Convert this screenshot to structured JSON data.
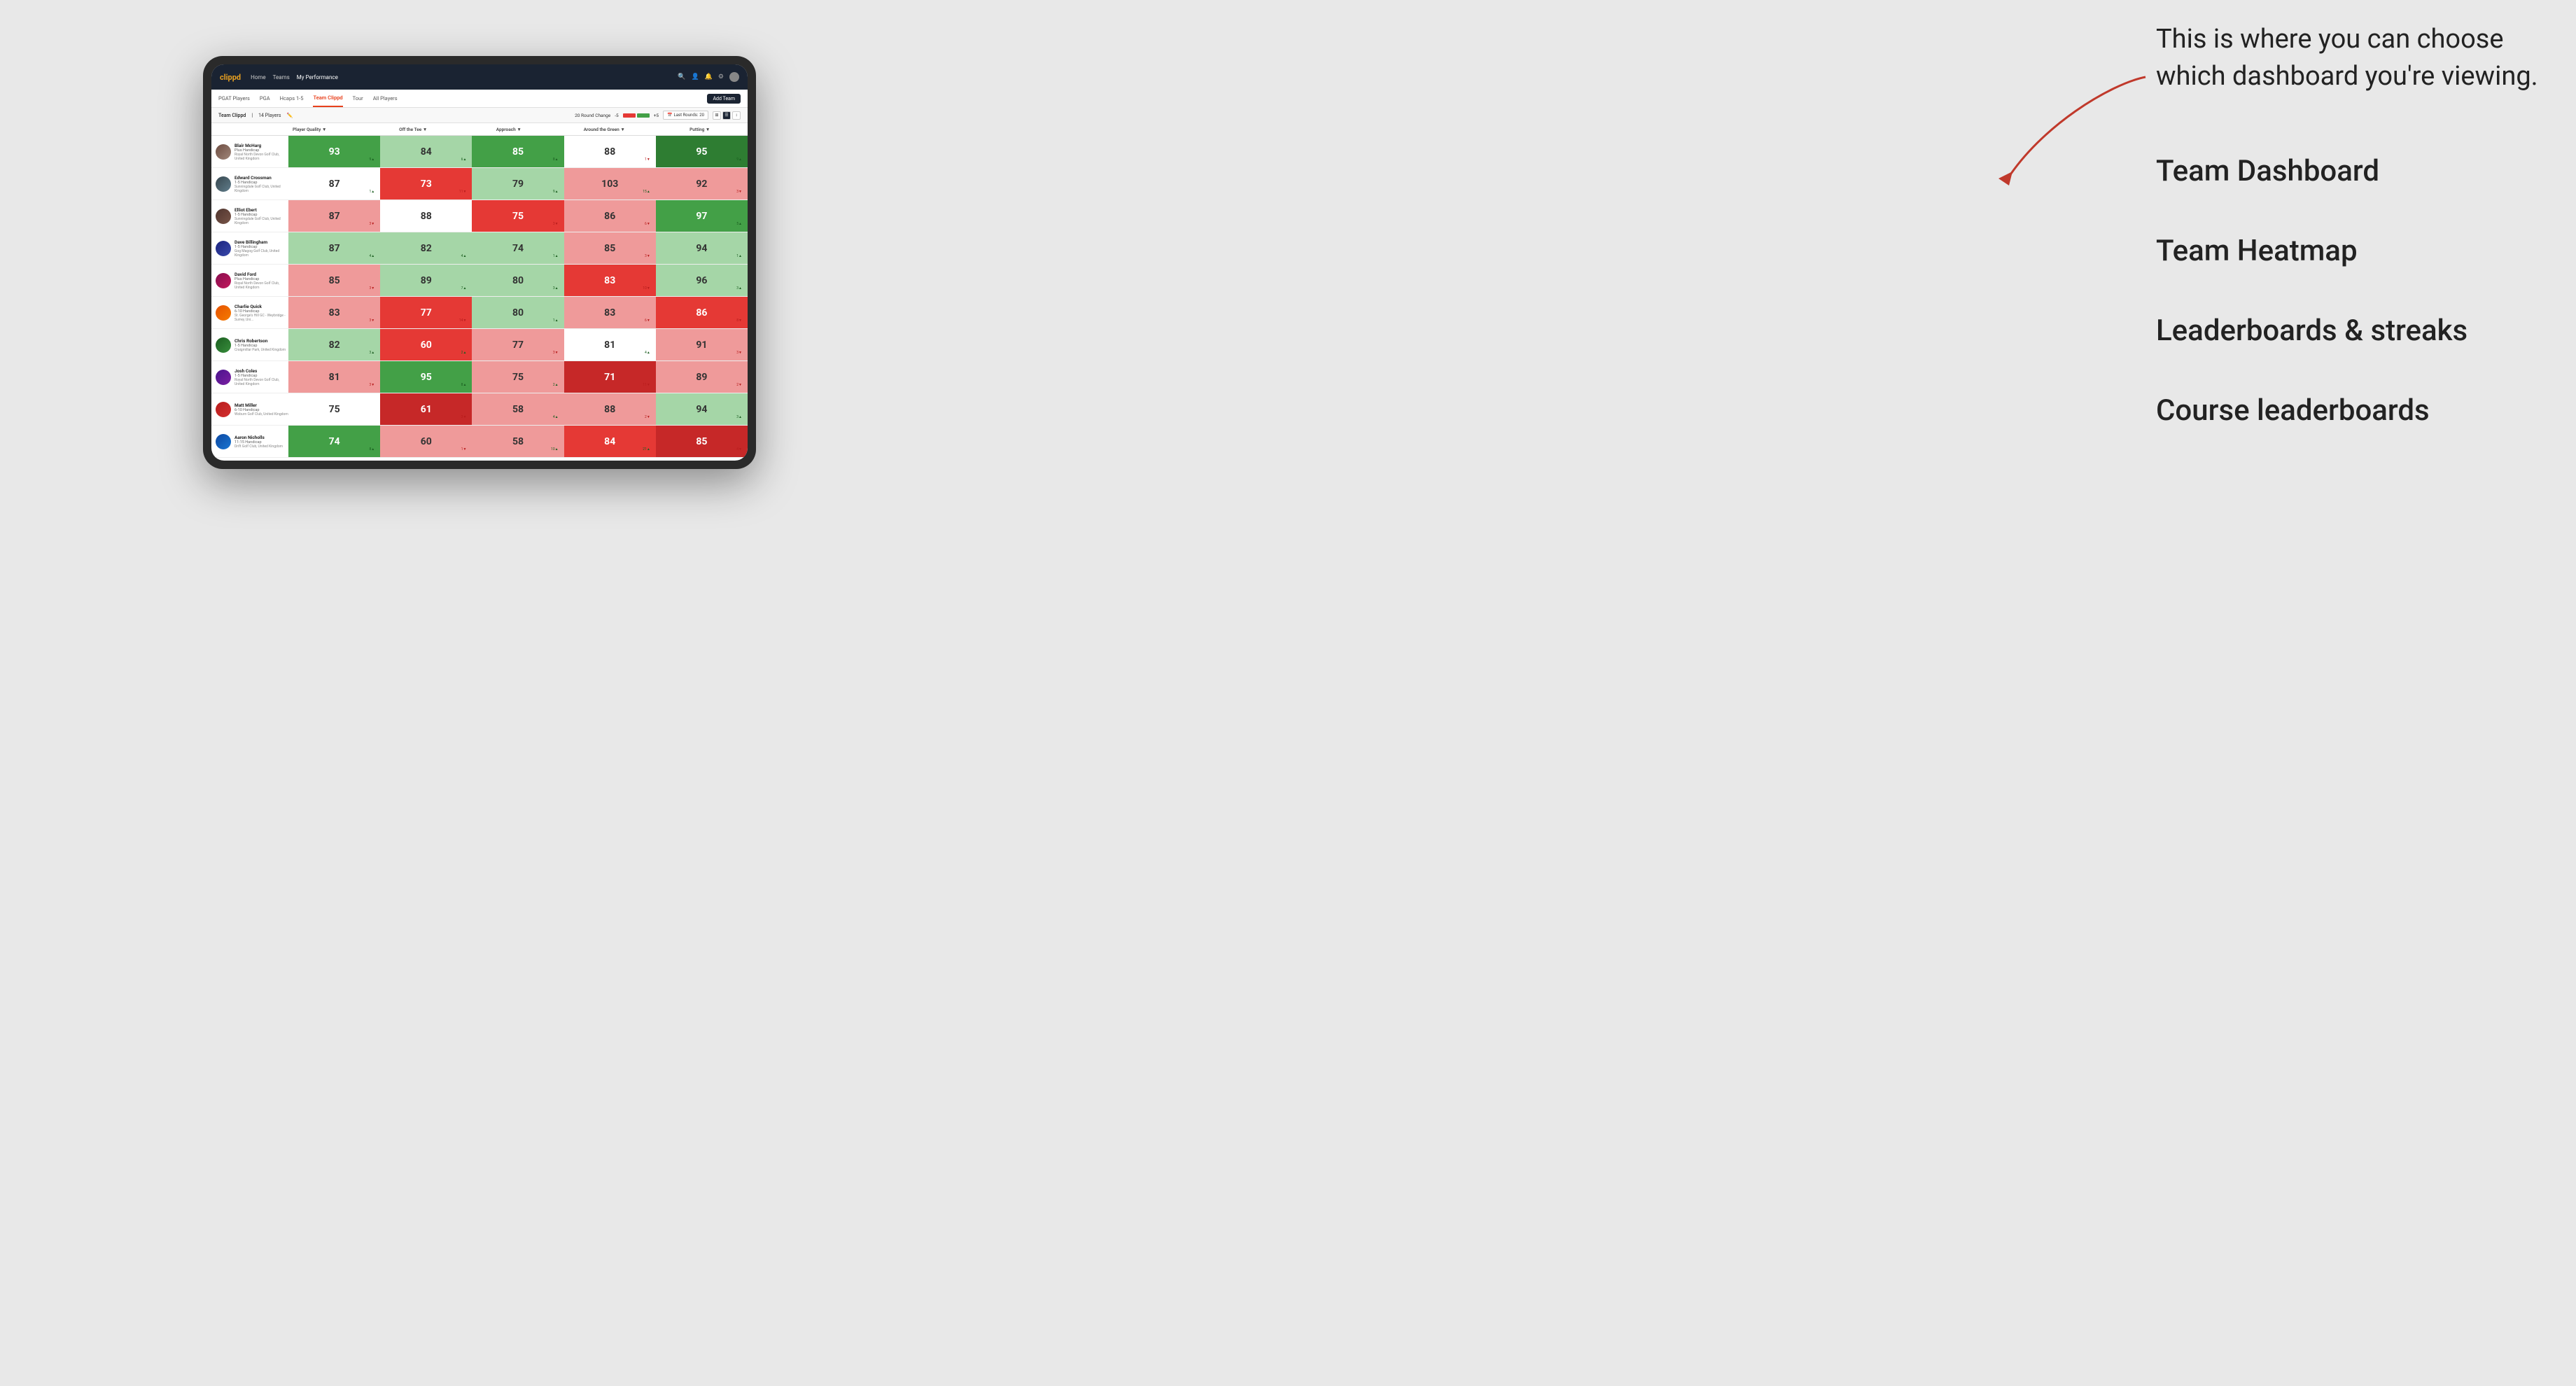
{
  "annotation": {
    "intro": "This is where you can choose which dashboard you're viewing.",
    "items": [
      "Team Dashboard",
      "Team Heatmap",
      "Leaderboards & streaks",
      "Course leaderboards"
    ]
  },
  "nav": {
    "logo": "clippd",
    "links": [
      "Home",
      "Teams",
      "My Performance"
    ],
    "active_link": "My Performance"
  },
  "sub_nav": {
    "links": [
      "PGAT Players",
      "PGA",
      "Hcaps 1-5",
      "Team Clippd",
      "Tour",
      "All Players"
    ],
    "active": "Team Clippd",
    "add_team": "Add Team"
  },
  "team_header": {
    "name": "Team Clippd",
    "separator": "|",
    "count": "14 Players",
    "round_change_label": "20 Round Change",
    "range_low": "-5",
    "range_high": "+5",
    "last_rounds_label": "Last Rounds:",
    "last_rounds_value": "20"
  },
  "table": {
    "col_headers": [
      "Player Quality ▼",
      "Off the Tee ▼",
      "Approach ▼",
      "Around the Green ▼",
      "Putting ▼"
    ],
    "players": [
      {
        "name": "Blair McHarg",
        "handicap": "Plus Handicap",
        "club": "Royal North Devon Golf Club, United Kingdom",
        "av_class": "av1",
        "scores": [
          {
            "val": 93,
            "change": "9▲",
            "dir": "up",
            "bg": "bg-green-med",
            "text": "score-main-white"
          },
          {
            "val": 84,
            "change": "6▲",
            "dir": "up",
            "bg": "bg-green-light",
            "text": "score-main-dark"
          },
          {
            "val": 85,
            "change": "8▲",
            "dir": "up",
            "bg": "bg-green-med",
            "text": "score-main-white"
          },
          {
            "val": 88,
            "change": "1▼",
            "dir": "down",
            "bg": "bg-white",
            "text": "score-main-dark"
          },
          {
            "val": 95,
            "change": "9▲",
            "dir": "up",
            "bg": "bg-green-dark",
            "text": "score-main-white"
          }
        ]
      },
      {
        "name": "Edward Crossman",
        "handicap": "1-5 Handicap",
        "club": "Sunningdale Golf Club, United Kingdom",
        "av_class": "av2",
        "scores": [
          {
            "val": 87,
            "change": "1▲",
            "dir": "up",
            "bg": "bg-white",
            "text": "score-main-dark"
          },
          {
            "val": 73,
            "change": "11▼",
            "dir": "down",
            "bg": "bg-red-med",
            "text": "score-main-white"
          },
          {
            "val": 79,
            "change": "9▲",
            "dir": "up",
            "bg": "bg-green-light",
            "text": "score-main-dark"
          },
          {
            "val": 103,
            "change": "15▲",
            "dir": "up",
            "bg": "bg-red-light",
            "text": "score-main-dark"
          },
          {
            "val": 92,
            "change": "3▼",
            "dir": "down",
            "bg": "bg-red-light",
            "text": "score-main-dark"
          }
        ]
      },
      {
        "name": "Elliot Ebert",
        "handicap": "1-5 Handicap",
        "club": "Sunningdale Golf Club, United Kingdom",
        "av_class": "av3",
        "scores": [
          {
            "val": 87,
            "change": "3▼",
            "dir": "down",
            "bg": "bg-red-light",
            "text": "score-main-dark"
          },
          {
            "val": 88,
            "change": "",
            "dir": "none",
            "bg": "bg-white",
            "text": "score-main-dark"
          },
          {
            "val": 75,
            "change": "3▼",
            "dir": "down",
            "bg": "bg-red-med",
            "text": "score-main-white"
          },
          {
            "val": 86,
            "change": "6▼",
            "dir": "down",
            "bg": "bg-red-light",
            "text": "score-main-dark"
          },
          {
            "val": 97,
            "change": "5▲",
            "dir": "up",
            "bg": "bg-green-med",
            "text": "score-main-white"
          }
        ]
      },
      {
        "name": "Dave Billingham",
        "handicap": "1-5 Handicap",
        "club": "Gog Magog Golf Club, United Kingdom",
        "av_class": "av4",
        "scores": [
          {
            "val": 87,
            "change": "4▲",
            "dir": "up",
            "bg": "bg-green-light",
            "text": "score-main-dark"
          },
          {
            "val": 82,
            "change": "4▲",
            "dir": "up",
            "bg": "bg-green-light",
            "text": "score-main-dark"
          },
          {
            "val": 74,
            "change": "1▲",
            "dir": "up",
            "bg": "bg-green-light",
            "text": "score-main-dark"
          },
          {
            "val": 85,
            "change": "3▼",
            "dir": "down",
            "bg": "bg-red-light",
            "text": "score-main-dark"
          },
          {
            "val": 94,
            "change": "1▲",
            "dir": "up",
            "bg": "bg-green-light",
            "text": "score-main-dark"
          }
        ]
      },
      {
        "name": "David Ford",
        "handicap": "Plus Handicap",
        "club": "Royal North Devon Golf Club, United Kingdom",
        "av_class": "av5",
        "scores": [
          {
            "val": 85,
            "change": "3▼",
            "dir": "down",
            "bg": "bg-red-light",
            "text": "score-main-dark"
          },
          {
            "val": 89,
            "change": "7▲",
            "dir": "up",
            "bg": "bg-green-light",
            "text": "score-main-dark"
          },
          {
            "val": 80,
            "change": "3▲",
            "dir": "up",
            "bg": "bg-green-light",
            "text": "score-main-dark"
          },
          {
            "val": 83,
            "change": "10▼",
            "dir": "down",
            "bg": "bg-red-med",
            "text": "score-main-white"
          },
          {
            "val": 96,
            "change": "3▲",
            "dir": "up",
            "bg": "bg-green-light",
            "text": "score-main-dark"
          }
        ]
      },
      {
        "name": "Charlie Quick",
        "handicap": "6-10 Handicap",
        "club": "St. George's Hill GC - Weybridge - Surrey, Uni...",
        "av_class": "av6",
        "scores": [
          {
            "val": 83,
            "change": "3▼",
            "dir": "down",
            "bg": "bg-red-light",
            "text": "score-main-dark"
          },
          {
            "val": 77,
            "change": "14▼",
            "dir": "down",
            "bg": "bg-red-med",
            "text": "score-main-white"
          },
          {
            "val": 80,
            "change": "1▲",
            "dir": "up",
            "bg": "bg-green-light",
            "text": "score-main-dark"
          },
          {
            "val": 83,
            "change": "6▼",
            "dir": "down",
            "bg": "bg-red-light",
            "text": "score-main-dark"
          },
          {
            "val": 86,
            "change": "8▼",
            "dir": "down",
            "bg": "bg-red-med",
            "text": "score-main-white"
          }
        ]
      },
      {
        "name": "Chris Robertson",
        "handicap": "1-5 Handicap",
        "club": "Craigmillar Park, United Kingdom",
        "av_class": "av7",
        "scores": [
          {
            "val": 82,
            "change": "3▲",
            "dir": "up",
            "bg": "bg-green-light",
            "text": "score-main-dark"
          },
          {
            "val": 60,
            "change": "2▲",
            "dir": "up",
            "bg": "bg-red-med",
            "text": "score-main-white"
          },
          {
            "val": 77,
            "change": "3▼",
            "dir": "down",
            "bg": "bg-red-light",
            "text": "score-main-dark"
          },
          {
            "val": 81,
            "change": "4▲",
            "dir": "up",
            "bg": "bg-white",
            "text": "score-main-dark"
          },
          {
            "val": 91,
            "change": "3▼",
            "dir": "down",
            "bg": "bg-red-light",
            "text": "score-main-dark"
          }
        ]
      },
      {
        "name": "Josh Coles",
        "handicap": "1-5 Handicap",
        "club": "Royal North Devon Golf Club, United Kingdom",
        "av_class": "av8",
        "scores": [
          {
            "val": 81,
            "change": "3▼",
            "dir": "down",
            "bg": "bg-red-light",
            "text": "score-main-dark"
          },
          {
            "val": 95,
            "change": "8▲",
            "dir": "up",
            "bg": "bg-green-med",
            "text": "score-main-white"
          },
          {
            "val": 75,
            "change": "2▲",
            "dir": "up",
            "bg": "bg-red-light",
            "text": "score-main-dark"
          },
          {
            "val": 71,
            "change": "11▼",
            "dir": "down",
            "bg": "bg-red-dark",
            "text": "score-main-white"
          },
          {
            "val": 89,
            "change": "2▼",
            "dir": "down",
            "bg": "bg-red-light",
            "text": "score-main-dark"
          }
        ]
      },
      {
        "name": "Matt Miller",
        "handicap": "6-10 Handicap",
        "club": "Woburn Golf Club, United Kingdom",
        "av_class": "av9",
        "scores": [
          {
            "val": 75,
            "change": "",
            "dir": "none",
            "bg": "bg-white",
            "text": "score-main-dark"
          },
          {
            "val": 61,
            "change": "3▼",
            "dir": "down",
            "bg": "bg-red-dark",
            "text": "score-main-white"
          },
          {
            "val": 58,
            "change": "4▲",
            "dir": "up",
            "bg": "bg-red-light",
            "text": "score-main-dark"
          },
          {
            "val": 88,
            "change": "2▼",
            "dir": "down",
            "bg": "bg-red-light",
            "text": "score-main-dark"
          },
          {
            "val": 94,
            "change": "3▲",
            "dir": "up",
            "bg": "bg-green-light",
            "text": "score-main-dark"
          }
        ]
      },
      {
        "name": "Aaron Nicholls",
        "handicap": "11-15 Handicap",
        "club": "Drift Golf Club, United Kingdom",
        "av_class": "av10",
        "scores": [
          {
            "val": 74,
            "change": "8▲",
            "dir": "up",
            "bg": "bg-green-med",
            "text": "score-main-white"
          },
          {
            "val": 60,
            "change": "1▼",
            "dir": "down",
            "bg": "bg-red-light",
            "text": "score-main-dark"
          },
          {
            "val": 58,
            "change": "10▲",
            "dir": "up",
            "bg": "bg-red-light",
            "text": "score-main-dark"
          },
          {
            "val": 84,
            "change": "21▲",
            "dir": "up",
            "bg": "bg-red-med",
            "text": "score-main-white"
          },
          {
            "val": 85,
            "change": "4▼",
            "dir": "down",
            "bg": "bg-red-dark",
            "text": "score-main-white"
          }
        ]
      }
    ]
  }
}
